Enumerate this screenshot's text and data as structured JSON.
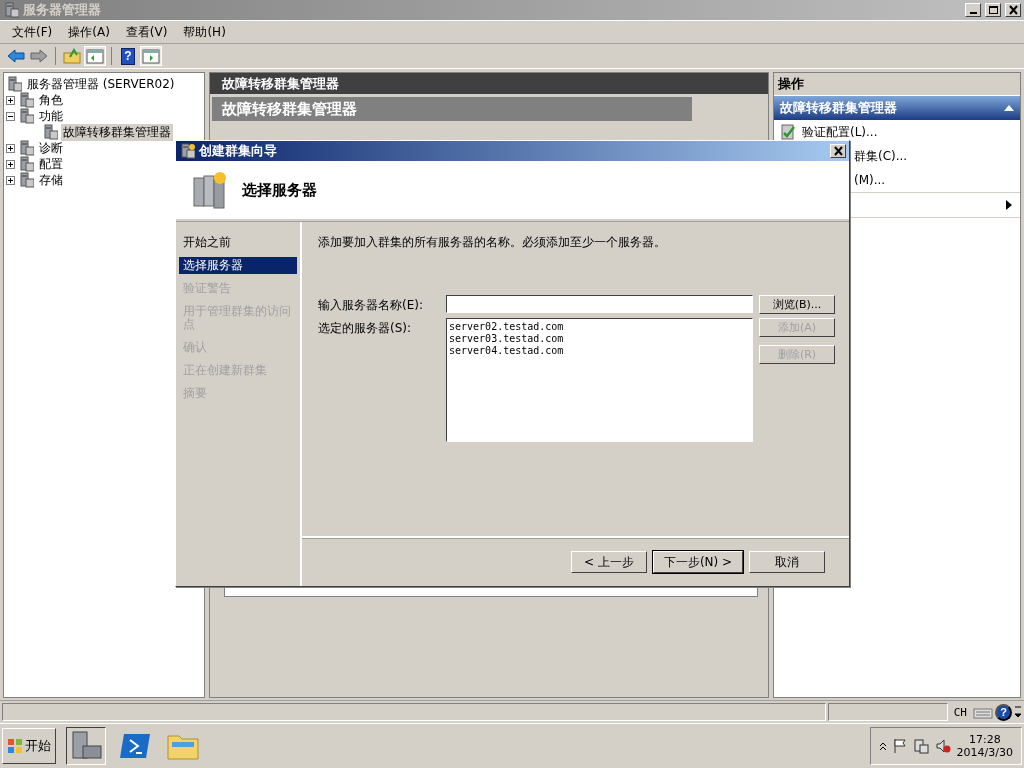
{
  "window": {
    "title": "服务器管理器"
  },
  "menu": [
    "文件(F)",
    "操作(A)",
    "查看(V)",
    "帮助(H)"
  ],
  "tree": {
    "root": "服务器管理器 (SERVER02)",
    "items": [
      {
        "label": "角色",
        "expanded": false,
        "selected": false
      },
      {
        "label": "功能",
        "expanded": true,
        "selected": false,
        "children": [
          {
            "label": "故障转移群集管理器",
            "selected": true
          }
        ]
      },
      {
        "label": "诊断",
        "expanded": false,
        "selected": false
      },
      {
        "label": "配置",
        "expanded": false,
        "selected": false
      },
      {
        "label": "存储",
        "expanded": false,
        "selected": false
      }
    ]
  },
  "center": {
    "header": "故障转移群集管理器",
    "banner": "故障转移群集管理器"
  },
  "toolbar": {
    "help": "?"
  },
  "actions": {
    "title": "操作",
    "section": "故障转移群集管理器",
    "expanded": true,
    "items": [
      {
        "label": "验证配置(L)...",
        "kind": "full"
      },
      {
        "label": "群集(C)...",
        "kind": "covered"
      },
      {
        "label": "(M)...",
        "kind": "covered"
      }
    ]
  },
  "dialog": {
    "title": "创建群集向导",
    "heading": "选择服务器",
    "steps": [
      {
        "label": "开始之前",
        "selected": false,
        "disabled": false
      },
      {
        "label": "选择服务器",
        "selected": true,
        "disabled": false
      },
      {
        "label": "验证警告",
        "selected": false,
        "disabled": true
      },
      {
        "label": "用于管理群集的访问点",
        "selected": false,
        "disabled": true
      },
      {
        "label": "确认",
        "selected": false,
        "disabled": true
      },
      {
        "label": "正在创建新群集",
        "selected": false,
        "disabled": true
      },
      {
        "label": "摘要",
        "selected": false,
        "disabled": true
      }
    ],
    "instruction": "添加要加入群集的所有服务器的名称。必须添加至少一个服务器。",
    "name_label": "输入服务器名称(E):",
    "selected_label": "选定的服务器(S):",
    "servers": [
      "server02.testad.com",
      "server03.testad.com",
      "server04.testad.com"
    ],
    "side_buttons": [
      {
        "label": "浏览(B)...",
        "disabled": false
      },
      {
        "label": "添加(A)",
        "disabled": true
      },
      {
        "label": "删除(R)",
        "disabled": true
      }
    ],
    "buttons": [
      {
        "label": "< 上一步",
        "default": false
      },
      {
        "label": "下一步(N) >",
        "default": true
      },
      {
        "label": "取消",
        "default": false
      }
    ]
  },
  "status_bar": {
    "language": "CH",
    "help": "?"
  },
  "taskbar": {
    "start": "开始",
    "time": "17:28",
    "date": "2014/3/30"
  }
}
